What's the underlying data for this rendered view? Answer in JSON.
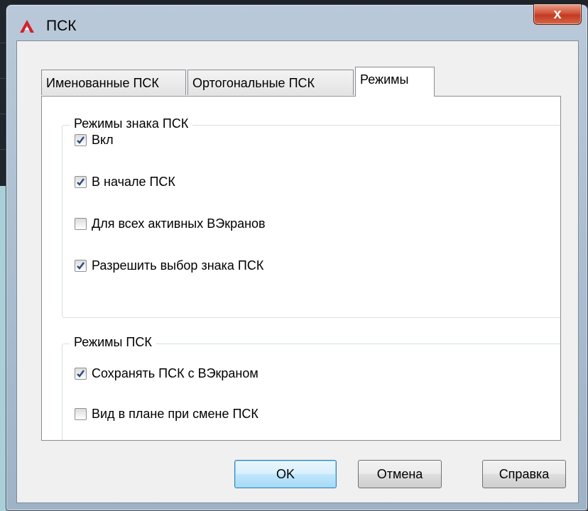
{
  "window": {
    "title": "ПСК",
    "close_glyph": "x"
  },
  "tabs": [
    {
      "label": "Именованные ПСК",
      "active": false
    },
    {
      "label": "Ортогональные ПСК",
      "active": false
    },
    {
      "label": "Режимы",
      "active": true
    }
  ],
  "icon_mode_group": {
    "title": "Режимы знака ПСК",
    "options": [
      {
        "label": "Вкл",
        "checked": true
      },
      {
        "label": "В начале ПСК",
        "checked": true
      },
      {
        "label": "Для всех активных ВЭкранов",
        "checked": false
      },
      {
        "label": "Разрешить выбор знака ПСК",
        "checked": true
      }
    ]
  },
  "ucs_mode_group": {
    "title": "Режимы ПСК",
    "options": [
      {
        "label": "Сохранять ПСК с ВЭкраном",
        "checked": true
      },
      {
        "label": "Вид в плане при смене ПСК",
        "checked": false
      }
    ]
  },
  "buttons": {
    "ok": "OK",
    "cancel": "Отмена",
    "help": "Справка"
  },
  "colors": {
    "app_icon_red": "#d4202a",
    "close_red": "#c23a22",
    "default_button_border": "#3c7fb1",
    "check_mark": "#2c4a7a"
  },
  "icons": {
    "app": "autocad-app-icon",
    "close": "close-icon",
    "check": "check-icon"
  }
}
